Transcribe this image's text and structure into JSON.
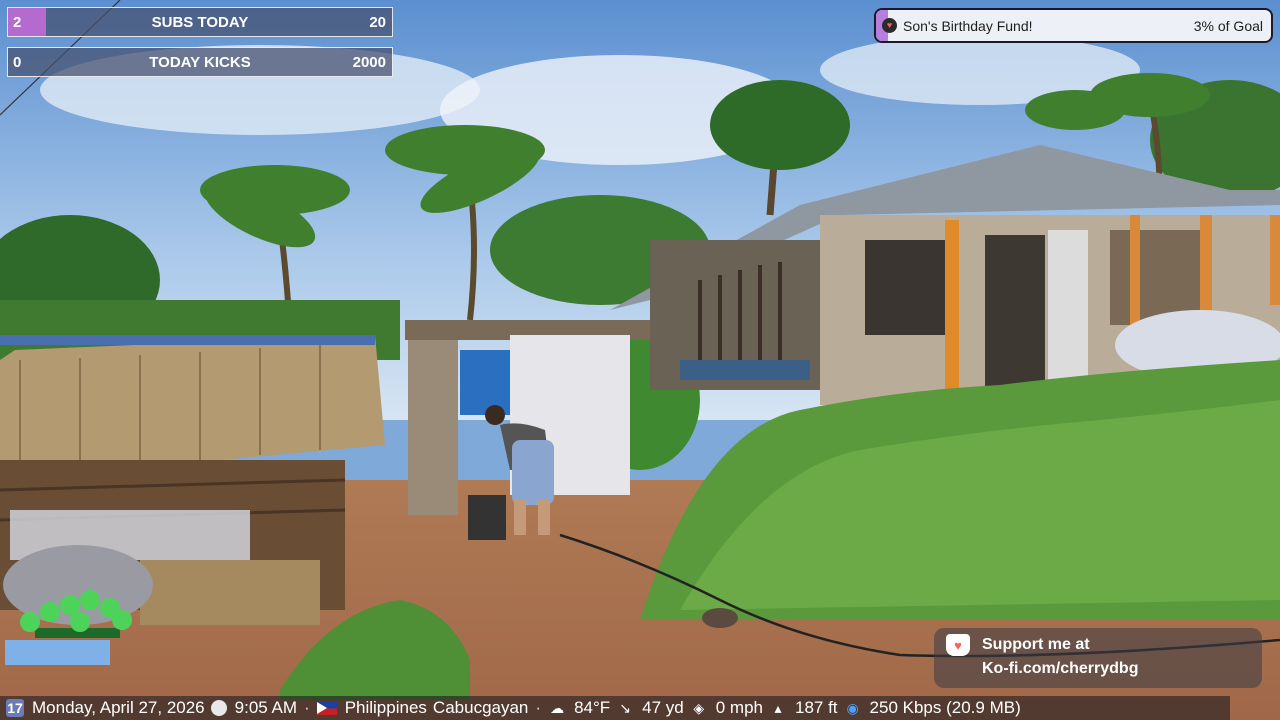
{
  "overlay": {
    "subs_goal": {
      "current": "2",
      "label": "SUBS TODAY",
      "target": "20",
      "progress": 0.1,
      "fill_color": "#b56ad0"
    },
    "kicks_goal": {
      "current": "0",
      "label": "TODAY KICKS",
      "target": "2000",
      "progress": 0.0
    },
    "kofi_goal": {
      "title": "Son's Birthday Fund!",
      "percent_text": "3% of Goal",
      "progress": 0.03,
      "icon": "kofi-cup-icon"
    },
    "support": {
      "line1": "Support me at",
      "line2": "Ko-fi.com/cherrydbg",
      "icon": "kofi-cup-icon"
    }
  },
  "status_bar": {
    "date": "Monday, April 27, 2026",
    "time": "9:05 AM",
    "country": "Philippines",
    "city": "Cabucgayan",
    "temperature": "84°F",
    "distance": "47 yd",
    "speed": "0 mph",
    "altitude": "187 ft",
    "bitrate": "250 Kbps (20.9 MB)",
    "separator": "·",
    "icons": [
      "calendar-icon",
      "clock-icon",
      "flag-icon",
      "weather-icon",
      "distance-icon",
      "speed-icon",
      "altitude-icon",
      "wifi-icon"
    ]
  },
  "colors": {
    "accent_purple": "#b56ad0",
    "kofi_red": "#ff5e5b"
  }
}
